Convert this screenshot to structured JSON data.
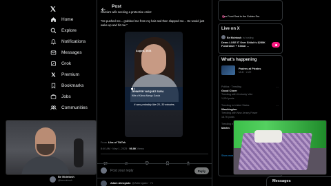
{
  "sidebar": {
    "items": [
      {
        "label": "Home",
        "icon": "home-icon"
      },
      {
        "label": "Explore",
        "icon": "search-icon"
      },
      {
        "label": "Notifications",
        "icon": "bell-icon"
      },
      {
        "label": "Messages",
        "icon": "mail-icon"
      },
      {
        "label": "Grok",
        "icon": "grok-icon"
      },
      {
        "label": "Premium",
        "icon": "x-premium-icon"
      },
      {
        "label": "Bookmarks",
        "icon": "bookmark-icon"
      },
      {
        "label": "Jobs",
        "icon": "briefcase-icon"
      },
      {
        "label": "Communities",
        "icon": "people-icon"
      }
    ],
    "profile": {
      "name": "Be Mcintosh",
      "handle": "@bemcintosh"
    }
  },
  "post": {
    "header": "Post",
    "text_top": "Garcia's wife seeking a protective order:",
    "quote": "\"He pushed me... grabbed me from my hair and then slapped me... He would just wake up and hit me.\"",
    "video": {
      "date": "August, 2024",
      "name": "JENNIFER VASQUEZ SURA",
      "role": "Wife of Kilmar Abrego Garcia",
      "caption": "It was probably like 20, 30 minutes."
    },
    "from": "From",
    "source": "Libs of TikTok",
    "meta_time": "8:40 AM · May 1, 2025 · ",
    "views": "98.8K",
    "views_label": "Views",
    "reply_placeholder": "Post your reply",
    "reply_button": "Reply",
    "next_author": "Adam Abrogado",
    "next_handle": "@AAbrogado · 7h"
  },
  "right": {
    "top_caption": "Your Front Seat to the Golden Era",
    "live_title": "Live on X",
    "live_host": "Be Mcintosh",
    "live_status": "is hosting",
    "live_text": "Dems LOSE IT Over Shiloh's $250K Fundraiser + Kilmar ...",
    "happening_title": "What's happening",
    "event_title": "Padres at Pirates",
    "event_sub": "MLB · LIVE",
    "trends": [
      {
        "context": "Politics · Trending",
        "topic": "Good Cheer",
        "sub": "Trending with Kentucky Vote",
        "count": "1,034 posts"
      },
      {
        "context": "Trending in United States",
        "topic": "Washington",
        "sub": "Trending with New Jersey Power",
        "count": "18.7K posts"
      },
      {
        "context": "Trending in United States",
        "topic": "Martin",
        "sub": "",
        "count": ""
      }
    ],
    "show_more": "Show more"
  },
  "messages_label": "Messages"
}
